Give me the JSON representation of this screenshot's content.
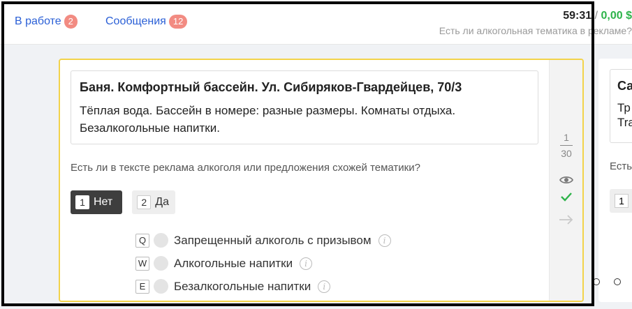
{
  "header": {
    "tabs": [
      {
        "label": "В работе",
        "count": "2"
      },
      {
        "label": "Сообщения",
        "count": "12"
      }
    ],
    "timer": "59:31",
    "separator": "/",
    "earnings": "0,00 $",
    "task_title": "Есть ли алкогольная тематика в рекламе?"
  },
  "task": {
    "title": "Баня. Комфортный бассейн. Ул. Сибиряков-Гвардейцев, 70/3",
    "body": "Тёплая вода. Бассейн в номере: разные размеры. Комнаты отдыха. Безалкогольные напитки.",
    "question": "Есть ли в тексте реклама алкоголя или предложения схожей тематики?",
    "answers": [
      {
        "key": "1",
        "label": "Нет",
        "selected": true
      },
      {
        "key": "2",
        "label": "Да",
        "selected": false
      }
    ],
    "options": [
      {
        "key": "Q",
        "label": "Запрещенный алкоголь с призывом",
        "info": "i"
      },
      {
        "key": "W",
        "label": "Алкогольные напитки",
        "info": "i"
      },
      {
        "key": "E",
        "label": "Безалкогольные напитки",
        "info": "i"
      }
    ]
  },
  "sidebar": {
    "current": "1",
    "total": "30",
    "icons": [
      "eye-icon",
      "check-icon",
      "arrow-right-icon"
    ]
  },
  "next_card": {
    "title": "Са",
    "body_line1": "Тр",
    "body_line2": "Tra",
    "question": "Есть",
    "key": "1"
  },
  "colors": {
    "accent_link": "#2a5fd6",
    "badge": "#f28b82",
    "card_border": "#f2d34b",
    "money": "#2db34a",
    "check": "#2db34a",
    "selected_answer": "#3e3e3e"
  }
}
